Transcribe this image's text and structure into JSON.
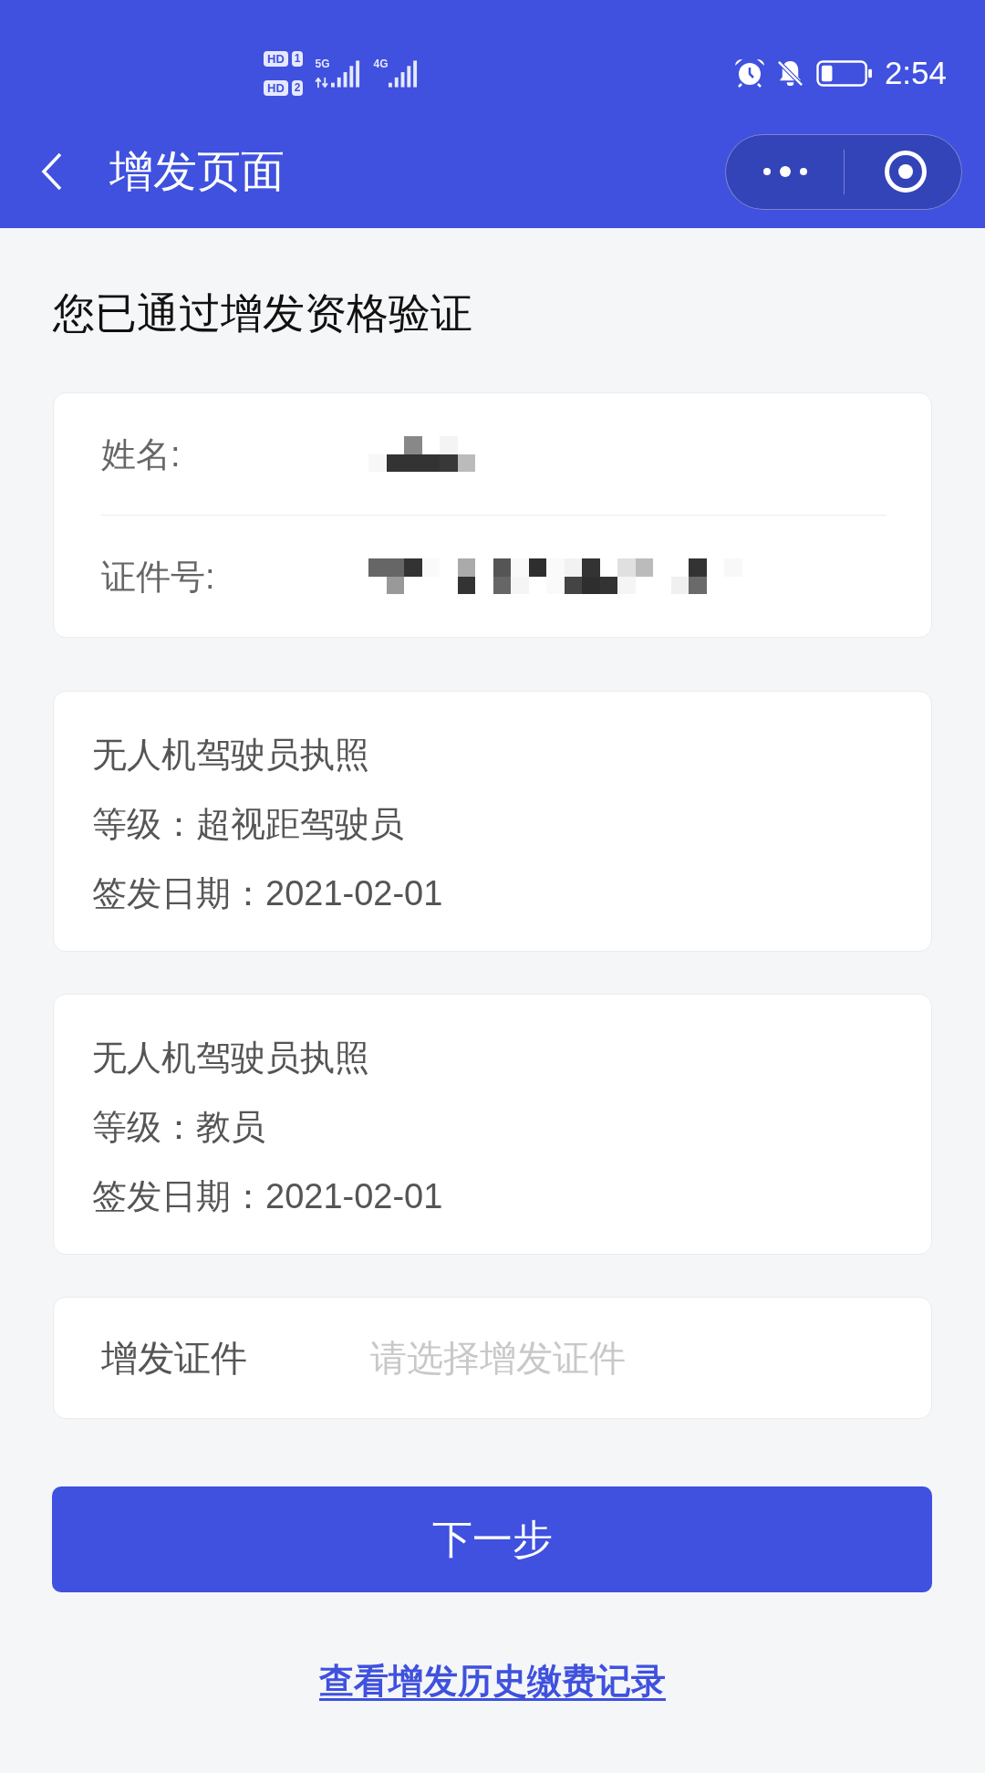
{
  "status_bar": {
    "sims": [
      {
        "label": "HD",
        "slot": "1"
      },
      {
        "label": "HD",
        "slot": "2"
      }
    ],
    "networks": [
      {
        "label": "5G",
        "data_activity": true
      },
      {
        "label": "4G",
        "data_activity": false
      }
    ],
    "time": "2:54"
  },
  "nav_bar": {
    "title": "增发页面"
  },
  "heading": "您已通过增发资格验证",
  "identity_card": {
    "fields": [
      {
        "label": "姓名:",
        "value_masked": true
      },
      {
        "label": "证件号:",
        "value_masked": true
      }
    ]
  },
  "licenses": [
    {
      "title": "无人机驾驶员执照",
      "grade": "等级：超视距驾驶员",
      "issue_date": "签发日期：2021-02-01"
    },
    {
      "title": "无人机驾驶员执照",
      "grade": "等级：教员",
      "issue_date": "签发日期：2021-02-01"
    }
  ],
  "select_field": {
    "label": "增发证件",
    "placeholder": "请选择增发证件"
  },
  "next_button": "下一步",
  "history_link": "查看增发历史缴费记录"
}
